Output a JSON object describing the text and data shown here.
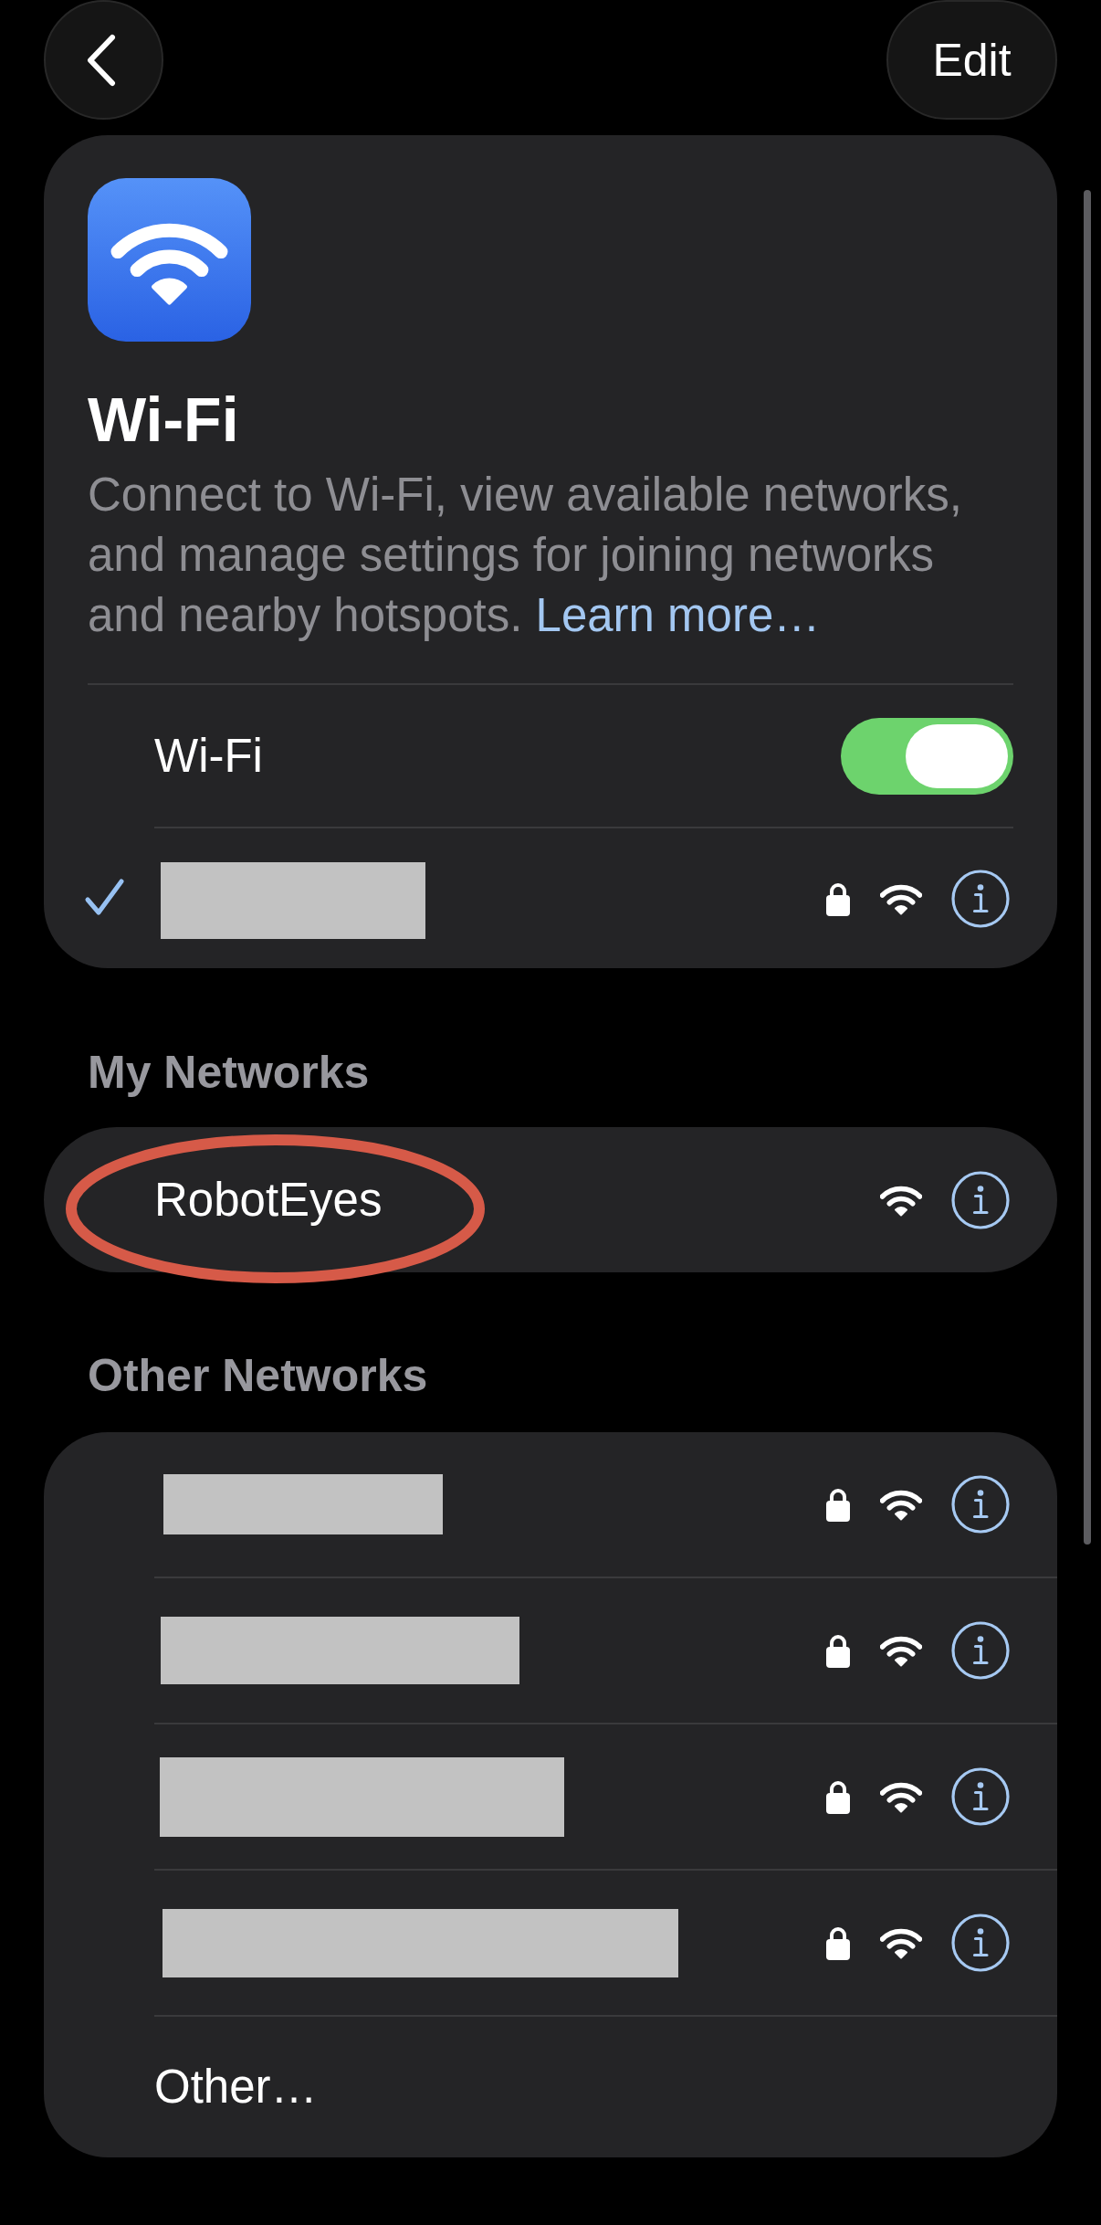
{
  "nav": {
    "edit_label": "Edit"
  },
  "wifi_card": {
    "title": "Wi-Fi",
    "description": "Connect to Wi-Fi, view available networks, and manage settings for joining networks and nearby hotspots.",
    "learn_more": "Learn more…",
    "toggle": {
      "label": "Wi-Fi",
      "on": true
    },
    "current_network": {
      "kind": "redacted",
      "selected": true,
      "secured": true
    }
  },
  "my_networks": {
    "title": "My Networks",
    "networks": [
      {
        "kind": "named",
        "name": "RobotEyes",
        "selected": false,
        "secured": false,
        "highlighted": true
      }
    ]
  },
  "other_networks": {
    "title": "Other Networks",
    "networks": [
      {
        "kind": "redacted",
        "selected": false,
        "secured": true
      },
      {
        "kind": "redacted",
        "selected": false,
        "secured": true
      },
      {
        "kind": "redacted",
        "selected": false,
        "secured": true
      },
      {
        "kind": "redacted",
        "selected": false,
        "secured": true
      }
    ],
    "other_label": "Other…"
  }
}
